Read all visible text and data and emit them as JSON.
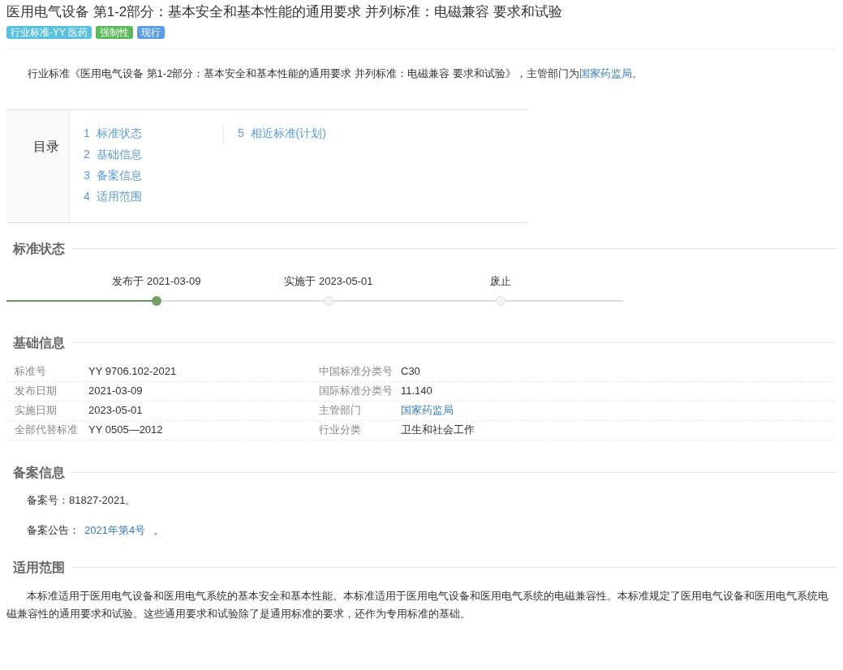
{
  "title": "医用电气设备 第1-2部分：基本安全和基本性能的通用要求 并列标准：电磁兼容 要求和试验",
  "tags": [
    {
      "label": "行业标准-YY 医药",
      "color": "#5bc0de"
    },
    {
      "label": "强制性",
      "color": "#5cb85c"
    },
    {
      "label": "现行",
      "color": "#5b9ee6"
    }
  ],
  "intro": {
    "before": "行业标准《医用电气设备 第1-2部分：基本安全和基本性能的通用要求 并列标准：电磁兼容 要求和试验》，主管部门为",
    "link": "国家药监局",
    "after": "。"
  },
  "toc": {
    "heading": "目录",
    "columns": [
      [
        "1  标准状态",
        "2  基础信息",
        "3  备案信息",
        "4  适用范围"
      ],
      [
        "5  相近标准(计划)"
      ]
    ]
  },
  "status": {
    "heading": "标准状态",
    "stages": [
      {
        "label": "发布于 2021-03-09",
        "reached": true
      },
      {
        "label": "实施于 2023-05-01",
        "reached": false
      },
      {
        "label": "废止",
        "reached": false
      }
    ]
  },
  "basic": {
    "heading": "基础信息",
    "rows": [
      [
        {
          "label": "标准号",
          "value": "YY 9706.102-2021",
          "kind": "text"
        },
        {
          "label": "中国标准分类号",
          "value": "C30",
          "kind": "text"
        }
      ],
      [
        {
          "label": "发布日期",
          "value": "2021-03-09",
          "kind": "text"
        },
        {
          "label": "国际标准分类号",
          "value": "11.140",
          "kind": "text"
        }
      ],
      [
        {
          "label": "实施日期",
          "value": "2023-05-01",
          "kind": "text"
        },
        {
          "label": "主管部门",
          "value": "国家药监局",
          "kind": "link"
        }
      ],
      [
        {
          "label": "全部代替标准",
          "value": "YY 0505—2012",
          "kind": "text"
        },
        {
          "label": "行业分类",
          "value": "卫生和社会工作",
          "kind": "text"
        }
      ]
    ]
  },
  "filing": {
    "heading": "备案信息",
    "number": "备案号：81827-2021。",
    "notice_label": "备案公告：",
    "notice_link": "2021年第4号",
    "notice_after": " 。"
  },
  "scope": {
    "heading": "适用范围",
    "text": "本标准适用于医用电气设备和医用电气系统的基本安全和基本性能。本标准适用于医用电气设备和医用电气系统的电磁兼容性。本标准规定了医用电气设备和医用电气系统电磁兼容性的通用要求和试验。这些通用要求和试验除了是通用标准的要求，还作为专用标准的基础。"
  }
}
